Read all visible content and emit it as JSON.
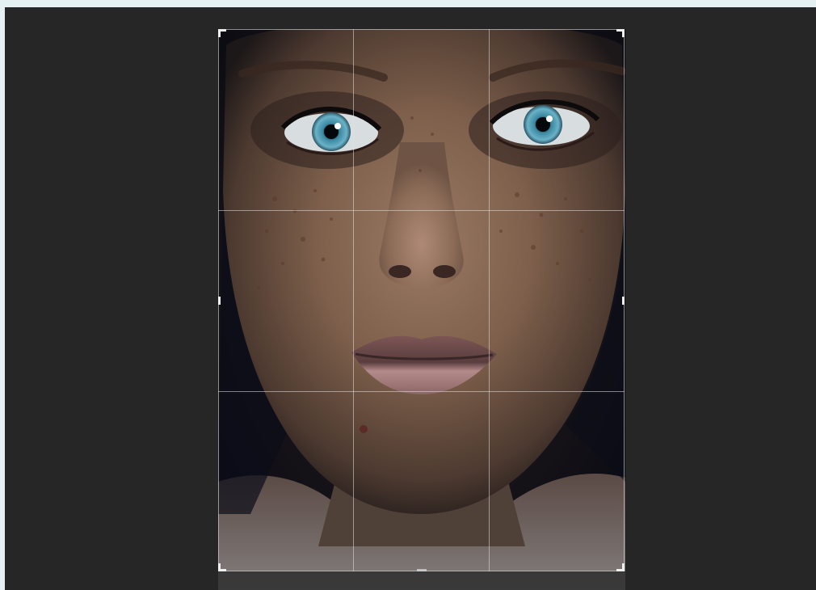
{
  "workspace": {
    "background_color": "#262626",
    "tool": "crop",
    "overlay": "rule-of-thirds-grid"
  },
  "image": {
    "subject": "portrait-photo",
    "accent_colors": {
      "skin": "#8a6a55",
      "shadow": "#0b0d1a",
      "eyes": "#5fa8c0",
      "lips": "#a87d7f"
    }
  },
  "crop": {
    "grid_divisions": 3,
    "handles": [
      "top-left",
      "top-right",
      "left-middle",
      "right-middle",
      "bottom-left",
      "bottom-right",
      "bottom-middle"
    ]
  }
}
